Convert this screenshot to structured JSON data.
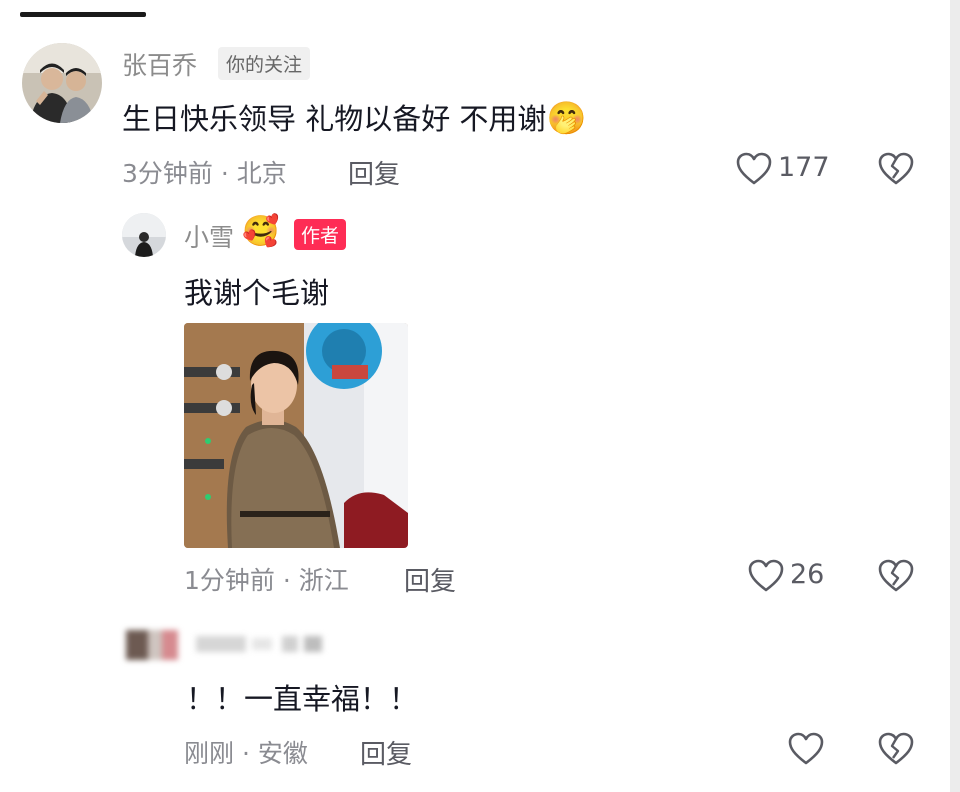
{
  "comments": [
    {
      "username": "张百乔",
      "tag": "你的关注",
      "text": "生日快乐领导 礼物以备好 不用谢",
      "emoji": "🤭",
      "time": "3分钟前",
      "location": "北京",
      "meta_sep": " · ",
      "reply_label": "回复",
      "likes": "177"
    },
    {
      "username": "小雪",
      "emoji": "🥰",
      "tag": "作者",
      "text": "我谢个毛谢",
      "time": "1分钟前",
      "location": "浙江",
      "meta_sep": " · ",
      "reply_label": "回复",
      "likes": "26"
    },
    {
      "text": "！！一直幸福！！",
      "time": "刚刚",
      "location": "安徽",
      "meta_sep": " · ",
      "reply_label": "回复"
    }
  ],
  "colors": {
    "author_tag": "#fe2c55",
    "text": "#161823",
    "muted": "#8a8b91"
  },
  "icons": [
    "heart-outline-icon",
    "broken-heart-icon"
  ]
}
